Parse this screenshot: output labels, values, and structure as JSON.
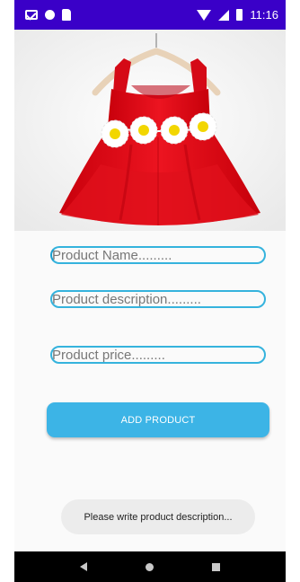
{
  "status_bar": {
    "time": "11:16",
    "icons": [
      "gmail-icon",
      "notification-dot-icon",
      "sd-card-icon",
      "wifi-icon",
      "signal-icon",
      "battery-icon"
    ],
    "background": "#3a00c8"
  },
  "product_image": {
    "subject": "red-dress-with-daisy-flowers"
  },
  "form": {
    "name_placeholder": "Product Name.........",
    "description_placeholder": "Product description.........",
    "price_placeholder": "Product price.........",
    "add_button_label": "ADD PRODUCT",
    "accent": "#3cb4e6"
  },
  "toast": {
    "message": "Please write product description..."
  },
  "nav_bar": {
    "icons": [
      "back-icon",
      "home-icon",
      "recents-icon"
    ]
  }
}
